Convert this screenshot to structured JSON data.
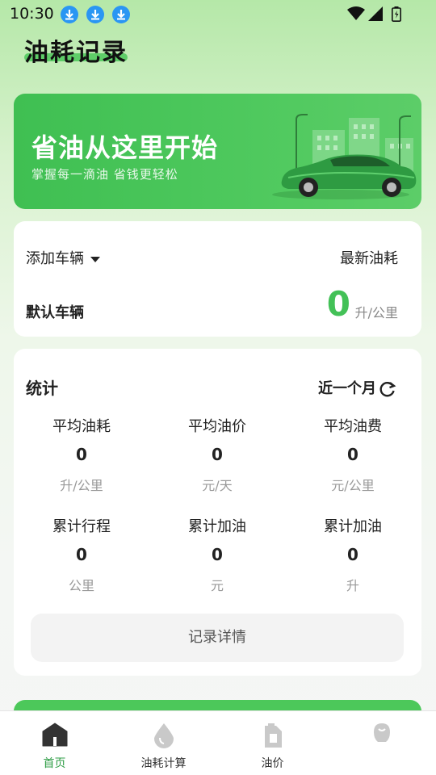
{
  "status_bar": {
    "time": "10:30"
  },
  "header": {
    "title": "油耗记录"
  },
  "banner": {
    "headline": "省油从这里开始",
    "subtitle": "掌握每一滴油  省钱更轻松"
  },
  "vehicle": {
    "add_label": "添加车辆",
    "latest_label": "最新油耗",
    "default_vehicle": "默认车辆",
    "latest_value": "0",
    "latest_unit": "升/公里"
  },
  "stats": {
    "title": "统计",
    "period": "近一个月",
    "items": [
      {
        "label": "平均油耗",
        "value": "0",
        "unit": "升/公里"
      },
      {
        "label": "平均油价",
        "value": "0",
        "unit": "元/天"
      },
      {
        "label": "平均油费",
        "value": "0",
        "unit": "元/公里"
      },
      {
        "label": "累计行程",
        "value": "0",
        "unit": "公里"
      },
      {
        "label": "累计加油",
        "value": "0",
        "unit": "元"
      },
      {
        "label": "累计加油",
        "value": "0",
        "unit": "升"
      }
    ],
    "detail_button": "记录详情"
  },
  "nav": {
    "items": [
      {
        "label": "首页",
        "icon": "home-icon",
        "active": true
      },
      {
        "label": "油耗计算",
        "icon": "oil-drop-icon",
        "active": false
      },
      {
        "label": "油价",
        "icon": "fuel-can-icon",
        "active": false
      },
      {
        "label": "",
        "icon": "profile-icon",
        "active": false
      }
    ]
  },
  "colors": {
    "accent": "#43c157",
    "nav_active": "#2f9d46",
    "banner": "#4cc85a"
  }
}
